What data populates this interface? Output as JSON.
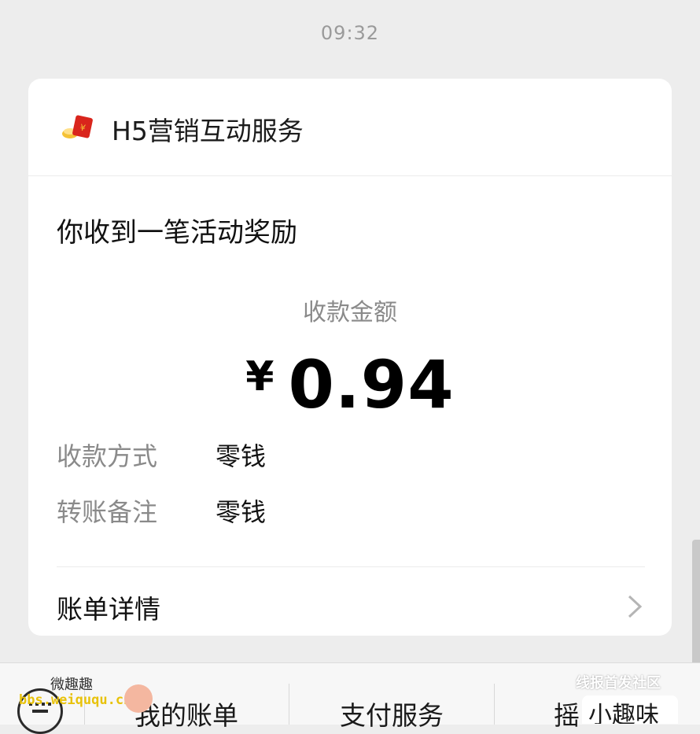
{
  "status": {
    "time": "09:32"
  },
  "message_card": {
    "sender_name": "H5营销互动服务",
    "sender_icon": "red-envelope-icon",
    "title": "你收到一笔活动奖励",
    "amount_label": "收款金额",
    "currency_symbol": "¥",
    "amount_value": "0.94",
    "rows": [
      {
        "label": "收款方式",
        "value": "零钱"
      },
      {
        "label": "转账备注",
        "value": "零钱"
      }
    ],
    "details_label": "账单详情",
    "details_icon": "chevron-right-icon"
  },
  "bottom_menu": {
    "keyboard_icon": "keyboard-icon",
    "items": [
      "我的账单",
      "支付服务",
      "摇"
    ]
  },
  "watermarks": {
    "left_top": "微趣趣",
    "left_url": "bbs.weiququ.cn",
    "right_top": "线报首发社区",
    "right_bottom": "小趣味"
  },
  "colors": {
    "background": "#ededed",
    "card": "#ffffff",
    "muted_text": "#8a8a8a",
    "envelope_red": "#d9251c",
    "coin_gold": "#f5c235"
  }
}
